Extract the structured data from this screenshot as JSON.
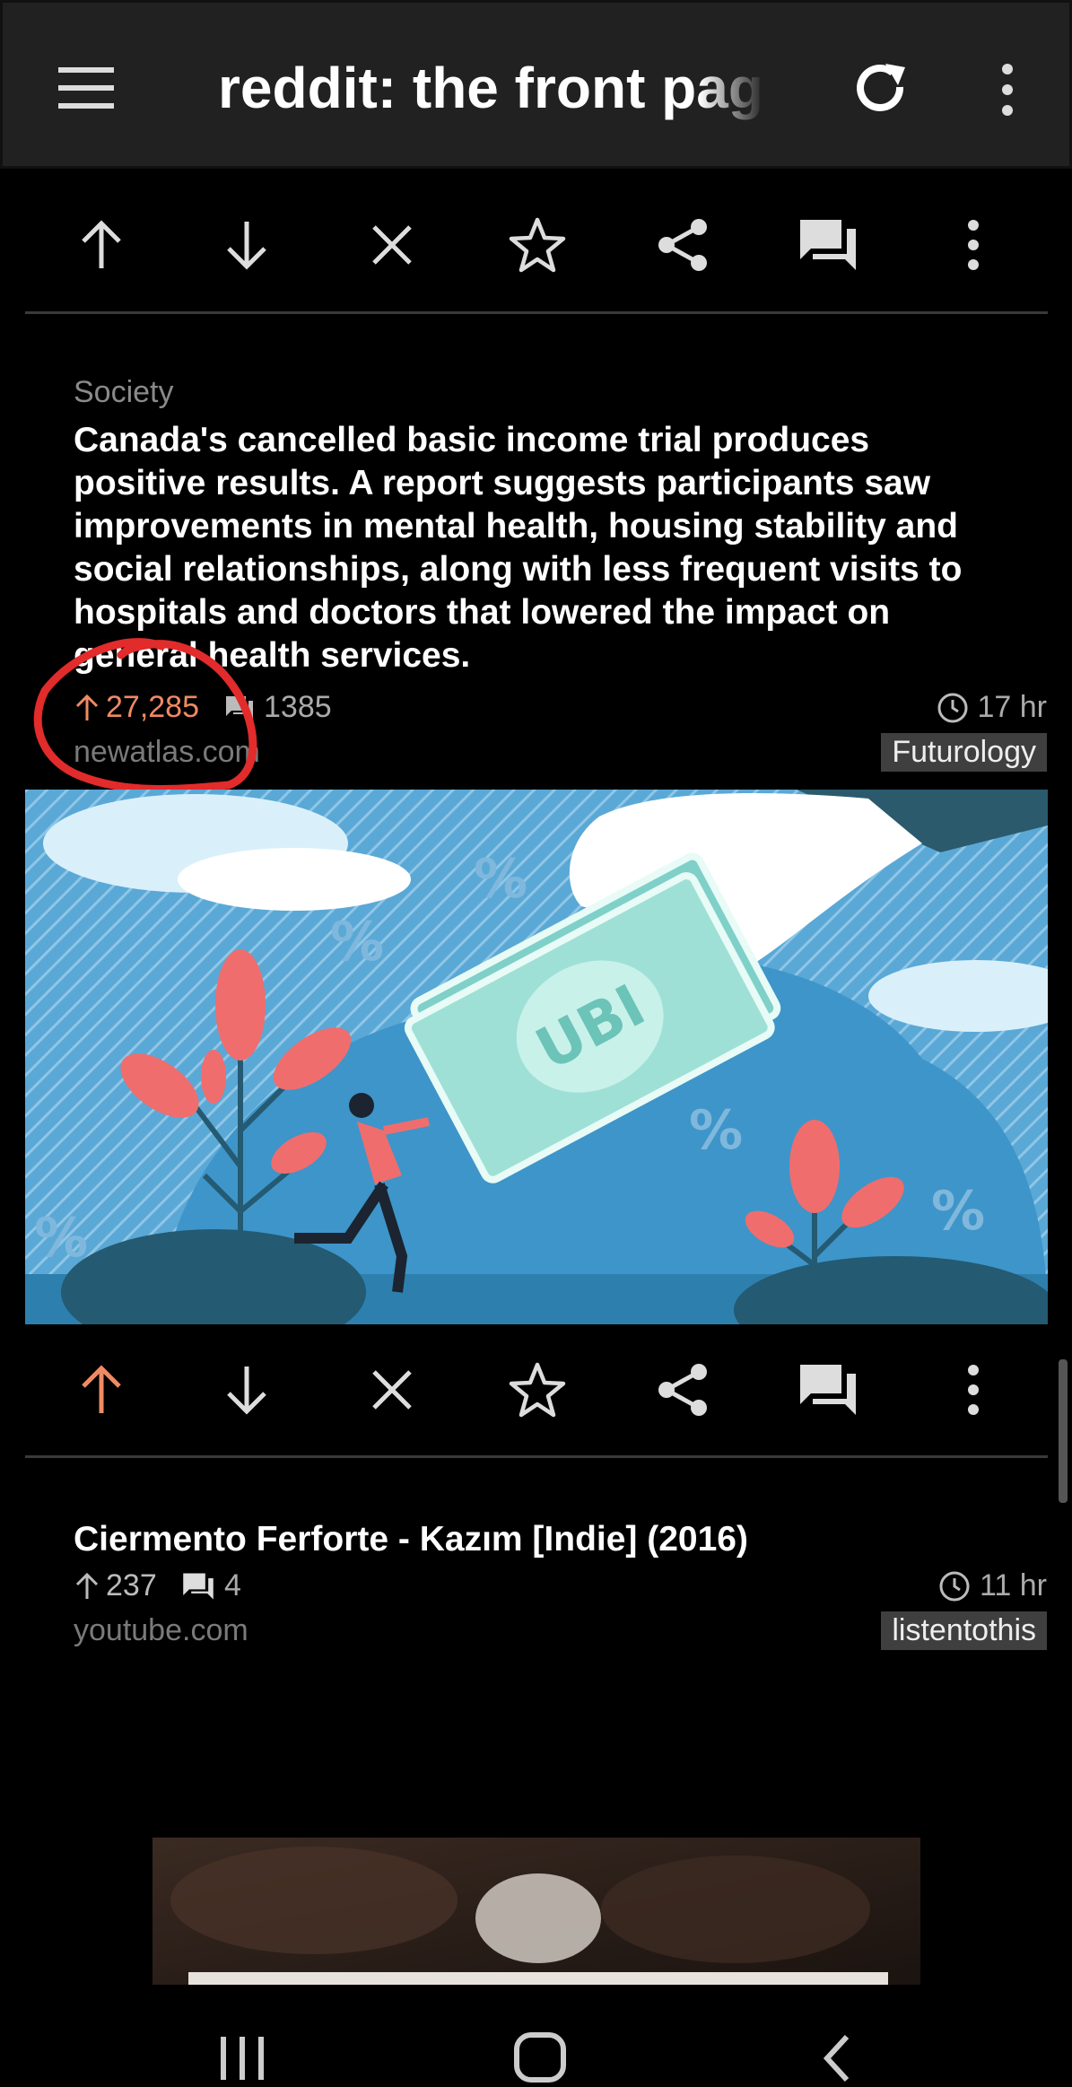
{
  "appbar": {
    "title": "reddit: the front page",
    "icons": [
      "menu-icon",
      "refresh-icon",
      "overflow-menu-icon"
    ]
  },
  "action_row": {
    "icons": [
      "upvote-icon",
      "downvote-icon",
      "hide-icon",
      "save-star-icon",
      "share-icon",
      "comments-icon",
      "more-icon"
    ]
  },
  "colors": {
    "upvote_active": "#f08a64",
    "appbar_bg": "#212121",
    "annotation_circle": "#e22b2b"
  },
  "posts": [
    {
      "flair": "Society",
      "title": "Canada's cancelled basic income trial produces positive results. A report suggests participants saw improvements in mental health, housing stability and social relationships, along with less frequent visits to hospitals and doctors that lowered the impact on general health services.",
      "score": "27,285",
      "comments": "1385",
      "age": "17 hr",
      "domain": "newatlas.com",
      "subreddit": "Futurology",
      "thumbnail_text": "UBI",
      "upvoted": true
    },
    {
      "title": "Ciermento Ferforte - Kazım [Indie] (2016)",
      "score": "237",
      "comments": "4",
      "age": "11 hr",
      "domain": "youtube.com",
      "subreddit": "listentothis",
      "upvoted": false
    }
  ],
  "navbar": {
    "icons": [
      "recent-apps-icon",
      "home-icon",
      "back-icon"
    ]
  }
}
